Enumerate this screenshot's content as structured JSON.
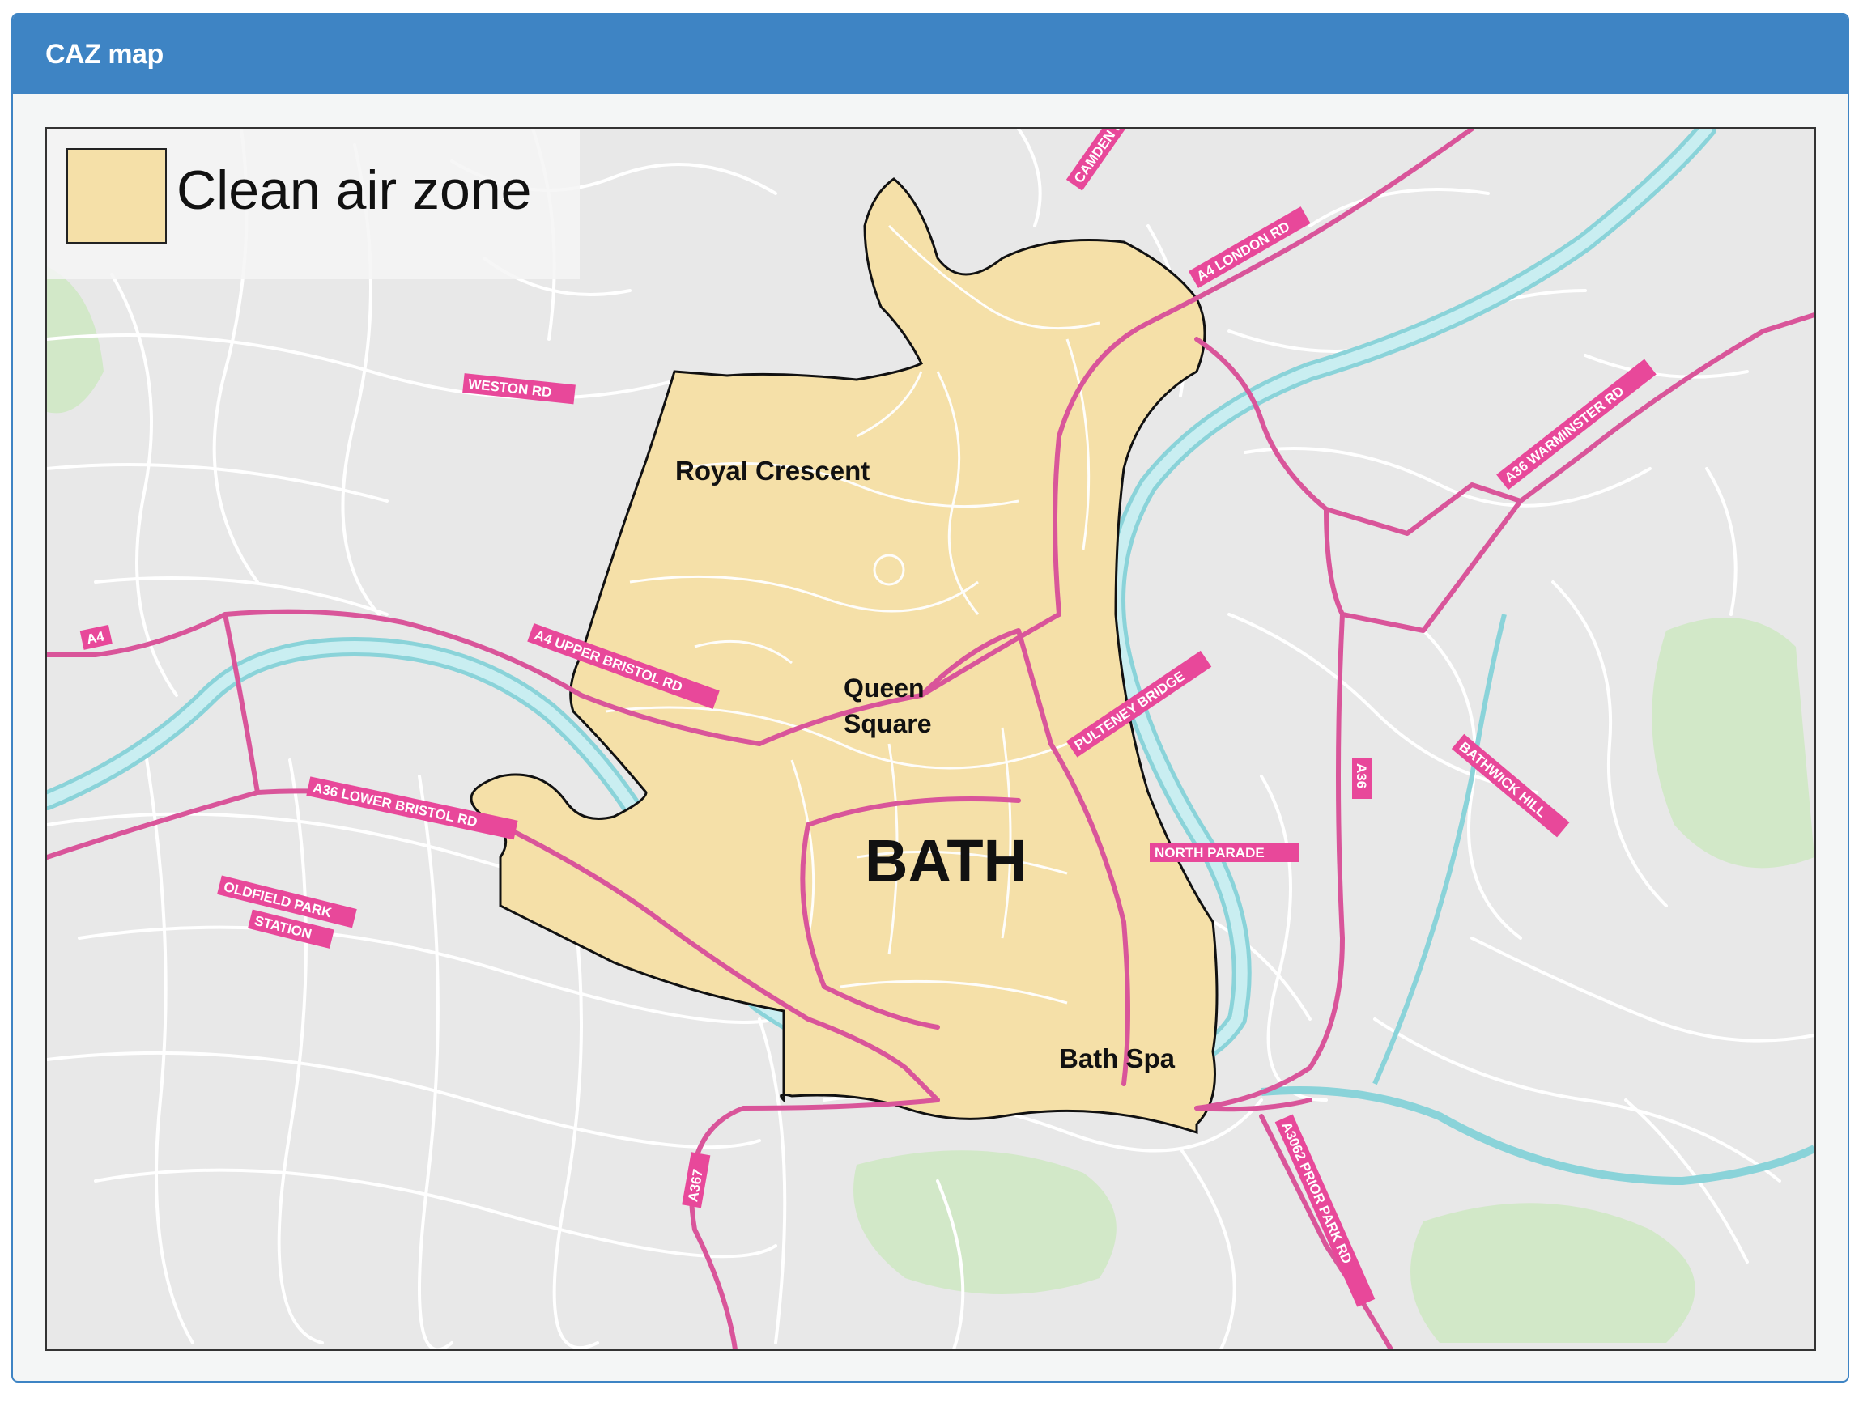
{
  "panel": {
    "title": "CAZ map"
  },
  "map": {
    "legend": {
      "label": "Clean air zone",
      "swatch_color": "#f5e0a8"
    },
    "colors": {
      "background": "#e8e8e8",
      "zone_fill": "#f5e0a8",
      "major_road": "#d9559a",
      "minor_road": "#ffffff",
      "river": "#b8e6ea",
      "park": "#cfe8c4",
      "label_bg": "#e8489a"
    },
    "places": {
      "city": "BATH",
      "royal_crescent": "Royal Crescent",
      "queen_square_1": "Queen",
      "queen_square_2": "Square",
      "bath_spa": "Bath Spa"
    },
    "road_labels": {
      "camden_rd": "CAMDEN RD",
      "a4_london_rd": "A4 LONDON RD",
      "weston_rd": "WESTON RD",
      "a36_warminster_rd": "A36 WARMINSTER RD",
      "a4": "A4",
      "a4_upper_bristol_rd": "A4 UPPER BRISTOL RD",
      "pulteney_bridge": "PULTENEY BRIDGE",
      "a36_lower_bristol_rd": "A36 LOWER BRISTOL RD",
      "a36": "A36",
      "bathwick_hill": "BATHWICK HILL",
      "oldfield_park_1": "OLDFIELD PARK",
      "oldfield_park_2": "STATION",
      "north_parade": "NORTH PARADE",
      "a367": "A367",
      "a3062_prior_park_rd": "A3062 PRIOR PARK RD"
    }
  }
}
